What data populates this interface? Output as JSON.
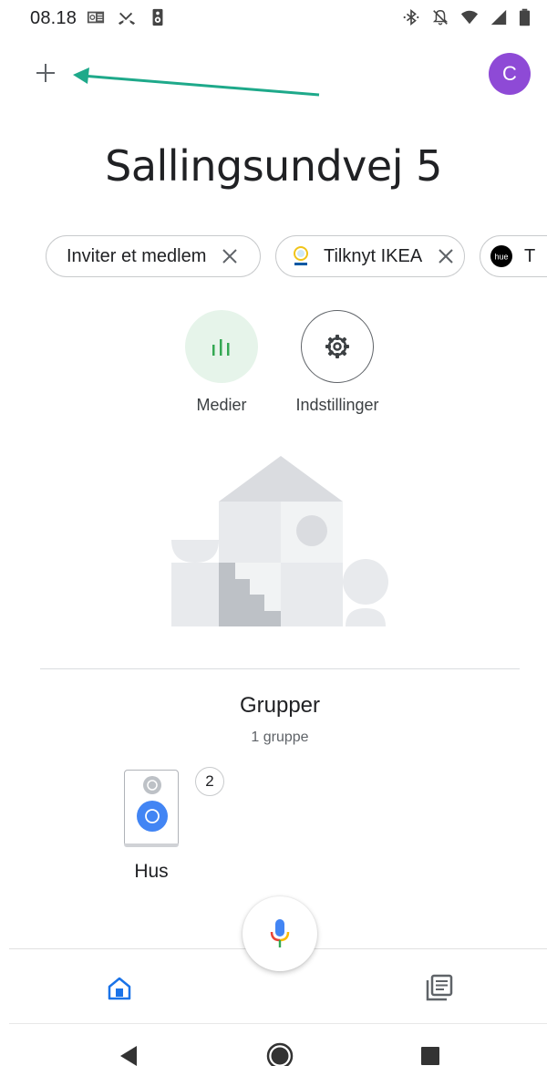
{
  "status_bar": {
    "time": "08.18",
    "left_icons": [
      "outlook-icon",
      "missed-call-icon",
      "speaker-icon"
    ],
    "right_icons": [
      "bluetooth-icon",
      "notifications-off-icon",
      "wifi-icon",
      "signal-icon",
      "battery-icon"
    ]
  },
  "header": {
    "add_icon": "plus-icon",
    "avatar_letter": "C",
    "avatar_color": "#8e4ad6",
    "annotation_arrow_color": "#1ea98a"
  },
  "home": {
    "title": "Sallingsundvej 5"
  },
  "chips": [
    {
      "label": "Inviter et medlem",
      "icon": null
    },
    {
      "label": "Tilknyt IKEA",
      "icon": "ikea-lamp-icon"
    },
    {
      "label": "T",
      "icon": "hue-icon",
      "icon_text": "hue"
    }
  ],
  "actions": [
    {
      "label": "Medier",
      "icon": "media-bars-icon",
      "color": "#34a853"
    },
    {
      "label": "Indstillinger",
      "icon": "gear-icon"
    }
  ],
  "groups": {
    "title": "Grupper",
    "subtitle": "1 gruppe",
    "items": [
      {
        "name": "Hus",
        "count": "2",
        "icon": "speaker-group-icon"
      }
    ]
  },
  "bottom_nav": {
    "items": [
      {
        "icon": "home-icon",
        "active": true,
        "color": "#1a73e8"
      },
      {
        "icon": "feed-icon",
        "active": false
      }
    ]
  },
  "mic_icon": "google-mic-icon",
  "system_nav": [
    "back-icon",
    "home-circle-icon",
    "recents-icon"
  ]
}
